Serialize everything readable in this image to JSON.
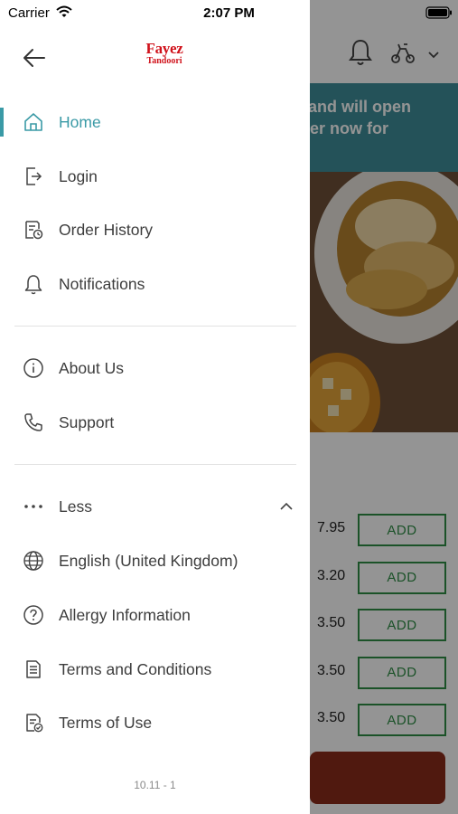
{
  "status_bar": {
    "carrier": "Carrier",
    "time": "2:07 PM"
  },
  "background": {
    "banner_lines": [
      "d and will open",
      "rder now for"
    ],
    "items": [
      {
        "price": "7.95",
        "button": "ADD"
      },
      {
        "price": "3.20",
        "button": "ADD"
      },
      {
        "price": "3.50",
        "button": "ADD"
      },
      {
        "price": "3.50",
        "button": "ADD"
      },
      {
        "price": "3.50",
        "button": "ADD"
      }
    ]
  },
  "drawer": {
    "logo": {
      "line1": "Fayez",
      "line2": "Tandoori"
    },
    "primary_items": [
      {
        "label": "Home",
        "icon": "home-icon",
        "active": true
      },
      {
        "label": "Login",
        "icon": "login-icon"
      },
      {
        "label": "Order History",
        "icon": "order-history-icon"
      },
      {
        "label": "Notifications",
        "icon": "bell-icon"
      }
    ],
    "secondary_items": [
      {
        "label": "About Us",
        "icon": "info-icon"
      },
      {
        "label": "Support",
        "icon": "phone-icon"
      }
    ],
    "more_toggle": {
      "label": "Less",
      "icon": "more-dots-icon"
    },
    "extra_items": [
      {
        "label": "English (United Kingdom)",
        "icon": "globe-icon"
      },
      {
        "label": "Allergy Information",
        "icon": "question-icon"
      },
      {
        "label": "Terms and Conditions",
        "icon": "document-icon"
      },
      {
        "label": "Terms of Use",
        "icon": "document-check-icon"
      }
    ],
    "version": "10.11 - 1"
  },
  "colors": {
    "accent": "#3a9aa6",
    "logo": "#d0121b",
    "add_button": "#2f8d46"
  }
}
